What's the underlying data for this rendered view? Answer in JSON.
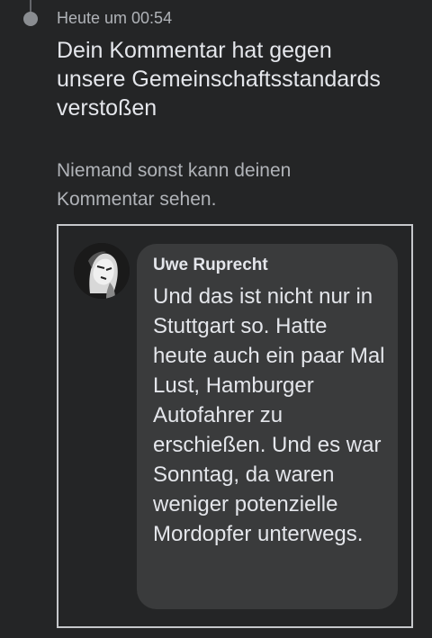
{
  "notification": {
    "timestamp": "Heute um 00:54",
    "title": "Dein Kommentar hat gegen unsere Gemeinschaftsstandards verstoßen",
    "subtitle": "Niemand sonst kann deinen Kommentar sehen."
  },
  "comment": {
    "author": "Uwe Ruprecht",
    "text": "Und das ist nicht nur in Stuttgart so. Hatte heute auch ein paar Mal Lust, Hamburger Autofahrer zu erschießen. Und es war Sonntag, da waren weniger potenzielle Mordopfer unterwegs."
  }
}
